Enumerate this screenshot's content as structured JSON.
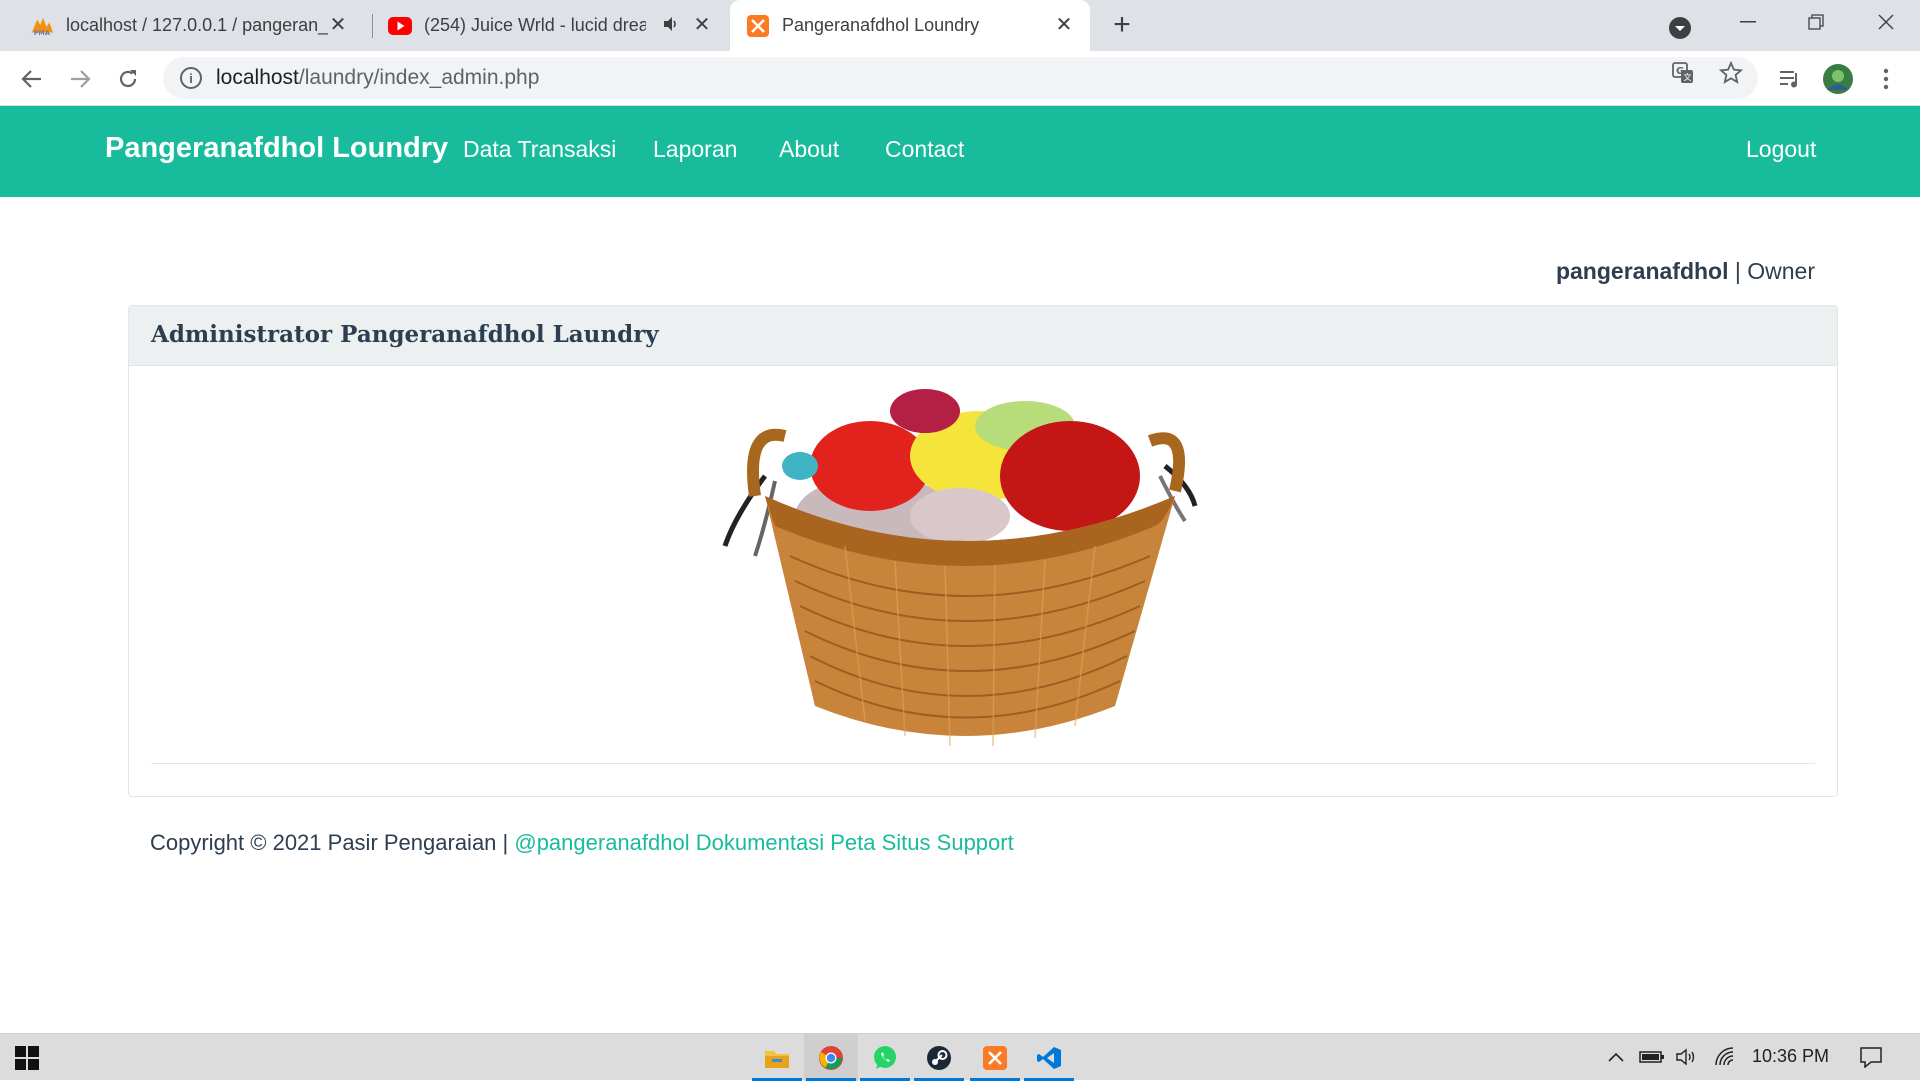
{
  "browser": {
    "tabs": [
      {
        "title": "localhost / 127.0.0.1 / pangeran_l",
        "icon": "phpmyadmin-icon"
      },
      {
        "title": "(254) Juice Wrld - lucid drear",
        "icon": "youtube-icon",
        "audio_icon": "speaker-icon"
      },
      {
        "title": "Pangeranafdhol Loundry",
        "icon": "xampp-icon"
      }
    ],
    "url_host": "localhost",
    "url_path": "/laundry/index_admin.php"
  },
  "navbar": {
    "brand": "Pangeranafdhol Loundry",
    "links": [
      "Data Transaksi",
      "Laporan",
      "About",
      "Contact"
    ],
    "logout": "Logout",
    "color": "#18bc9c"
  },
  "user": {
    "name": "pangeranafdhol",
    "separator": " | ",
    "role": "Owner"
  },
  "card": {
    "header": "Administrator Pangeranafdhol Laundry",
    "image": "laundry-basket-image"
  },
  "footer": {
    "text": "Copyright © 2021 Pasir Pengaraian | ",
    "links": [
      "@pangeranafdhol",
      "Dokumentasi",
      "Peta Situs",
      "Support"
    ]
  },
  "taskbar": {
    "apps": [
      "file-explorer-icon",
      "chrome-icon",
      "whatsapp-icon",
      "steam-icon",
      "xampp-icon",
      "vscode-icon"
    ],
    "time": "10:36 PM"
  }
}
